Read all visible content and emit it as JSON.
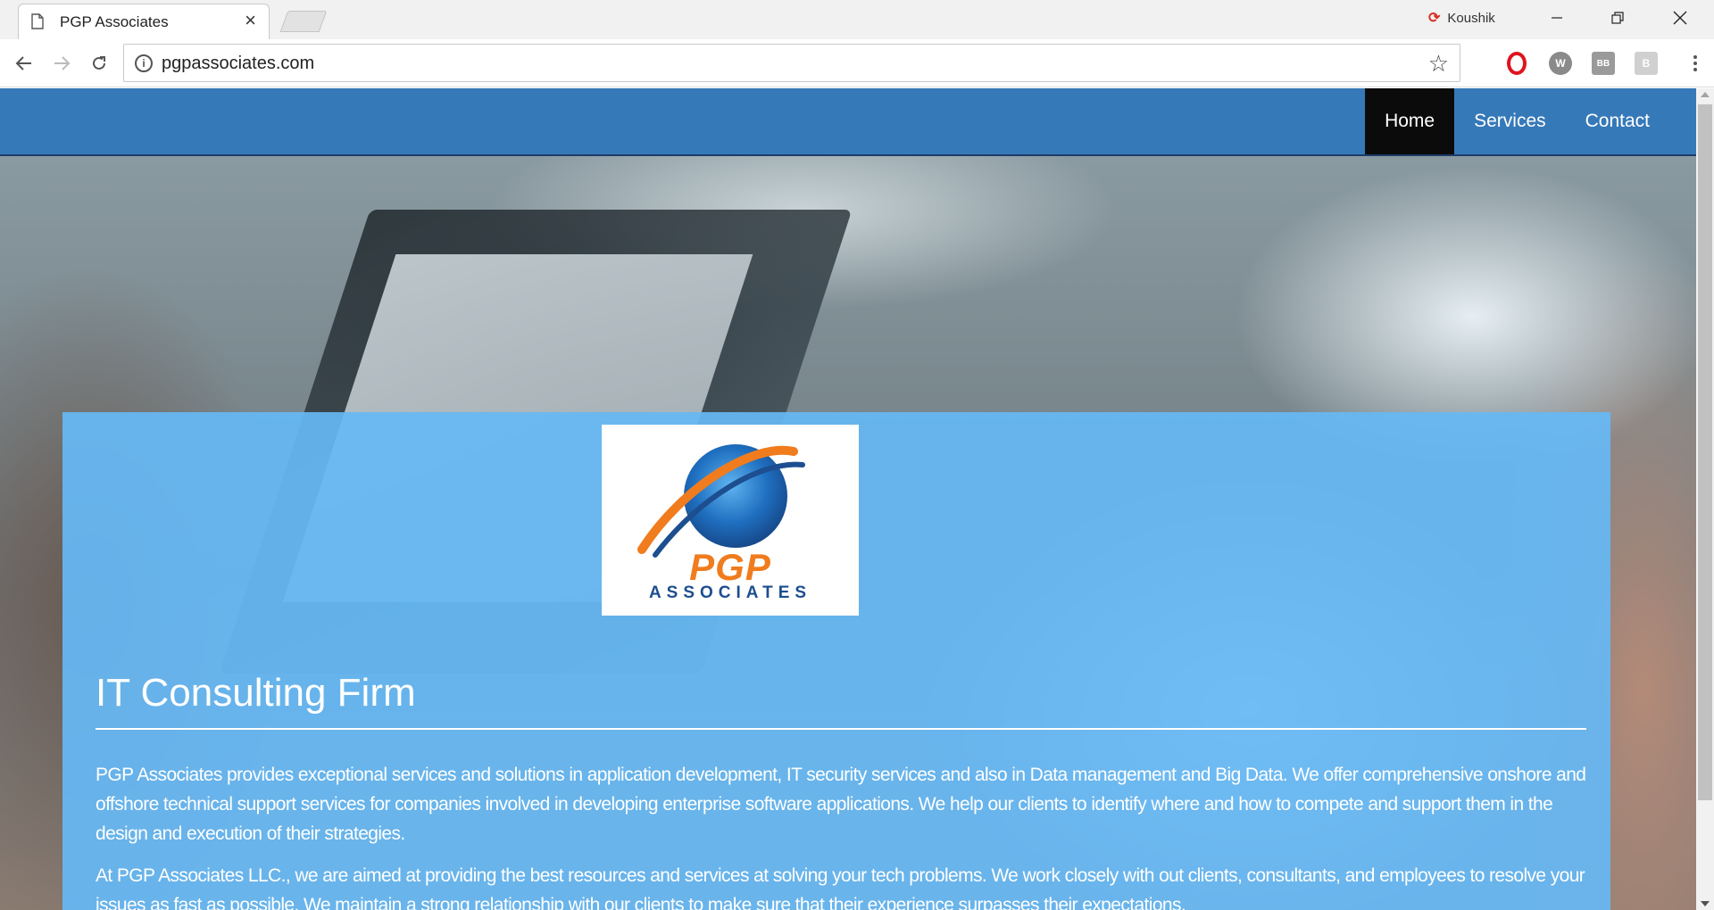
{
  "browser": {
    "tab_title": "PGP Associates",
    "tab_close": "×",
    "profile_name": "Koushik",
    "url": "pgpassociates.com",
    "extensions": [
      "opera-icon",
      "w-icon",
      "bb-icon",
      "b-icon"
    ],
    "extension_labels": {
      "w": "W",
      "bb": "BB",
      "b": "B"
    }
  },
  "site": {
    "nav": [
      {
        "label": "Home",
        "active": true
      },
      {
        "label": "Services",
        "active": false
      },
      {
        "label": "Contact",
        "active": false
      }
    ],
    "logo": {
      "wordmark": "PGP",
      "sub": "ASSOCIATES"
    },
    "heading": "IT Consulting Firm",
    "paragraphs": [
      "PGP Associates provides exceptional services and solutions in application development, IT security services and also in Data management and Big Data. We offer comprehensive onshore and offshore technical support services for companies involved in developing enterprise software applications. We help our clients to identify where and how to compete and support them in the design and execution of their strategies.",
      "At PGP Associates LLC., we are aimed at providing the best resources and services at solving your tech problems. We work closely with out clients, consultants, and employees to resolve your issues as fast as possible. We maintain a strong relationship with our clients to make sure that their experience surpasses their expectations."
    ]
  },
  "colors": {
    "nav_bg": "#3679b8",
    "nav_active_bg": "#0b0b0b",
    "panel_bg": "#66b8f5",
    "logo_orange": "#f07c1e",
    "logo_blue": "#1d4e8f"
  }
}
